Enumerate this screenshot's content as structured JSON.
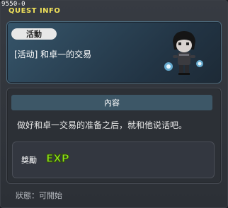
{
  "window": {
    "quest_id": "9550-0",
    "title": "QUEST INFO"
  },
  "header": {
    "badge_label": "活動",
    "quest_name": "[活动] 和卓一的交易"
  },
  "content": {
    "section_label": "內容",
    "description": "做好和卓一交易的准备之后，就和他说话吧。"
  },
  "reward": {
    "label": "獎勵",
    "exp_text": "EXP"
  },
  "status": {
    "label": "狀態：",
    "value": "可開始"
  },
  "colors": {
    "title": "#f0e15a",
    "exp_green": "#8fe31c",
    "header_panel": "#2a4254"
  },
  "icons": {
    "character": "npc-character-sprite",
    "exp": "exp-reward-icon"
  }
}
